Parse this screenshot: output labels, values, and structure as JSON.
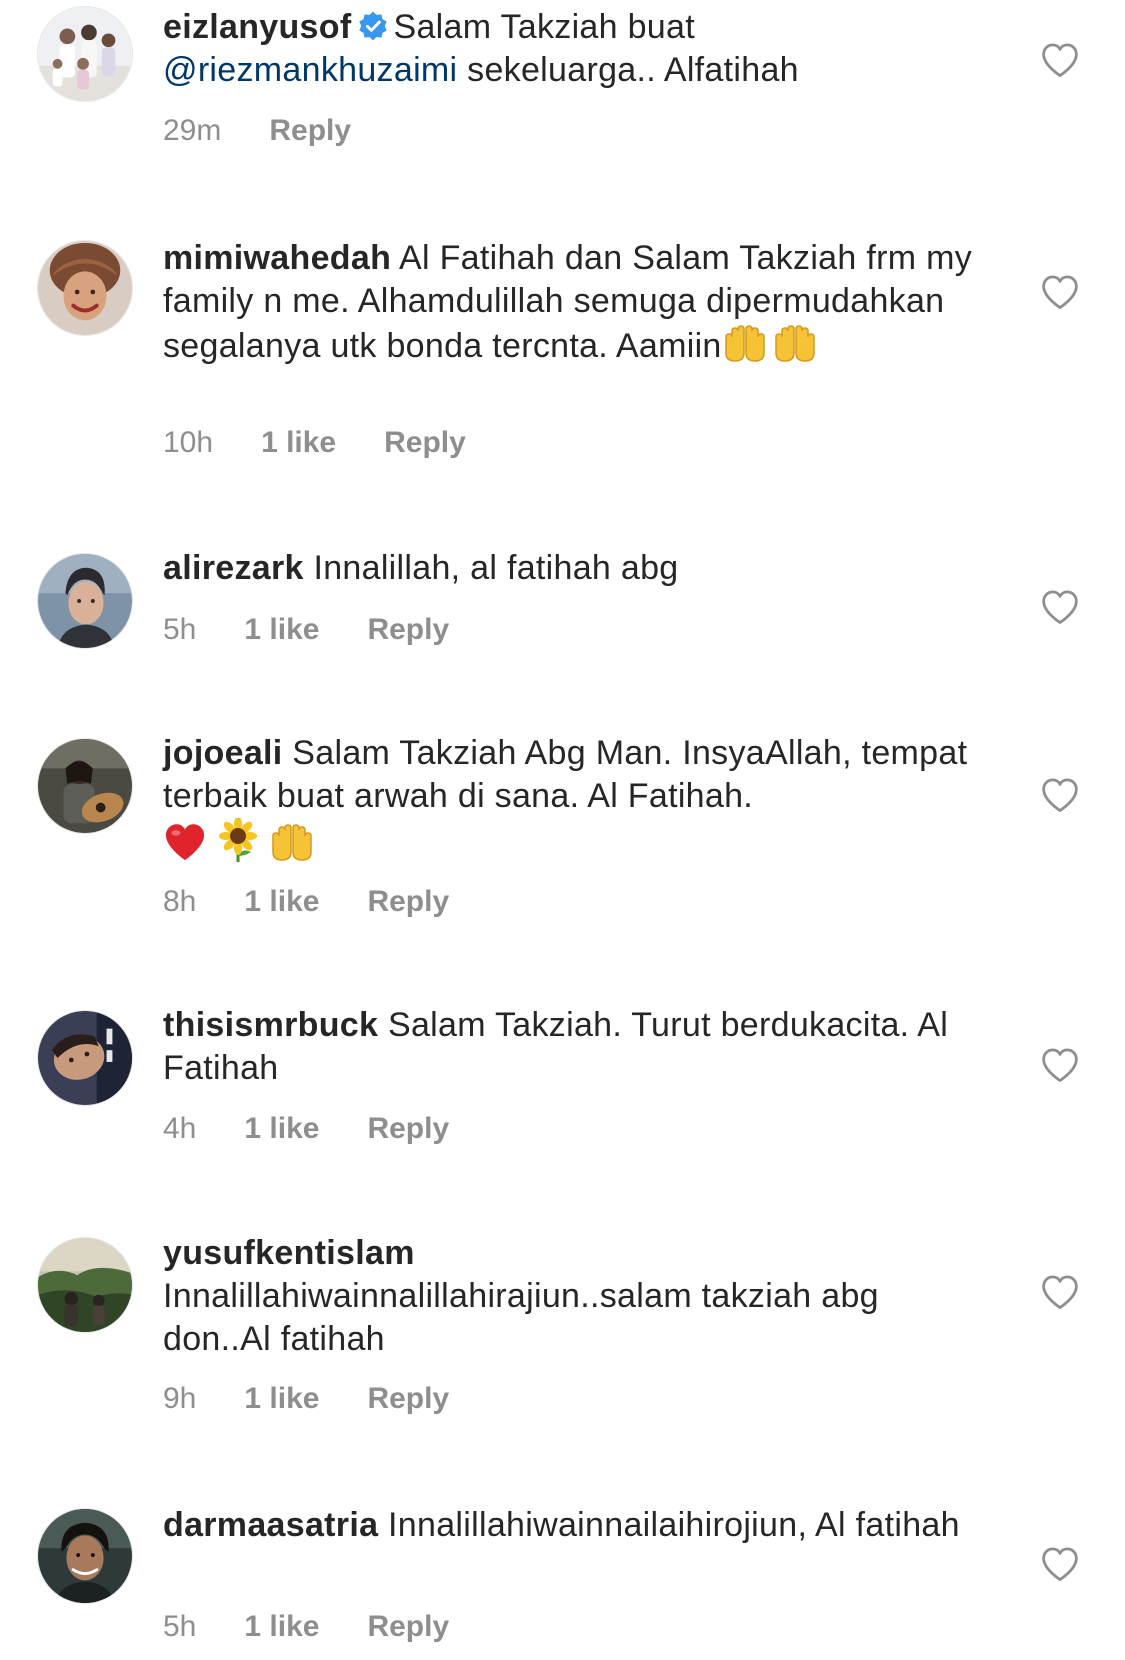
{
  "comments": [
    {
      "username": "eizlanyusof",
      "verified": true,
      "text_before_mention": "Salam Takziah buat",
      "mention": "@riezmankhuzaimi",
      "text": "sekeluarga.. Alfatihah",
      "time": "29m",
      "likes": "",
      "reply": "Reply"
    },
    {
      "username": "mimiwahedah",
      "text": "Al Fatihah dan Salam Takziah frm my family n me. Alhamdulillah semuga dipermudahkan segalanya utk bonda tercnta. Aamiin",
      "emojis": [
        "raised-hands",
        "raised-hands"
      ],
      "time": "10h",
      "likes": "1 like",
      "reply": "Reply"
    },
    {
      "username": "alirezark",
      "text": "Innalillah, al fatihah abg",
      "time": "5h",
      "likes": "1 like",
      "reply": "Reply"
    },
    {
      "username": "jojoeali",
      "text": "Salam Takziah Abg Man. InsyaAllah, tempat terbaik buat arwah di sana. Al Fatihah.",
      "emojis": [
        "red-heart",
        "sunflower",
        "raised-hands"
      ],
      "time": "8h",
      "likes": "1 like",
      "reply": "Reply"
    },
    {
      "username": "thisismrbuck",
      "text": "Salam Takziah. Turut berdukacita. Al Fatihah",
      "time": "4h",
      "likes": "1 like",
      "reply": "Reply"
    },
    {
      "username": "yusufkentislam",
      "text": "Innalillahiwainnalillahirajiun..salam takziah abg don..Al fatihah",
      "time": "9h",
      "likes": "1 like",
      "reply": "Reply"
    },
    {
      "username": "darmaasatria",
      "text": "Innalillahiwainnailaihirojiun, Al fatihah",
      "time": "5h",
      "likes": "1 like",
      "reply": "Reply"
    }
  ],
  "icons": {
    "like": "heart-outline-icon",
    "verified": "verified-badge-icon"
  },
  "colors": {
    "text": "#262626",
    "meta": "#8e8e8e",
    "mention": "#00376b",
    "verified": "#3897f0"
  }
}
